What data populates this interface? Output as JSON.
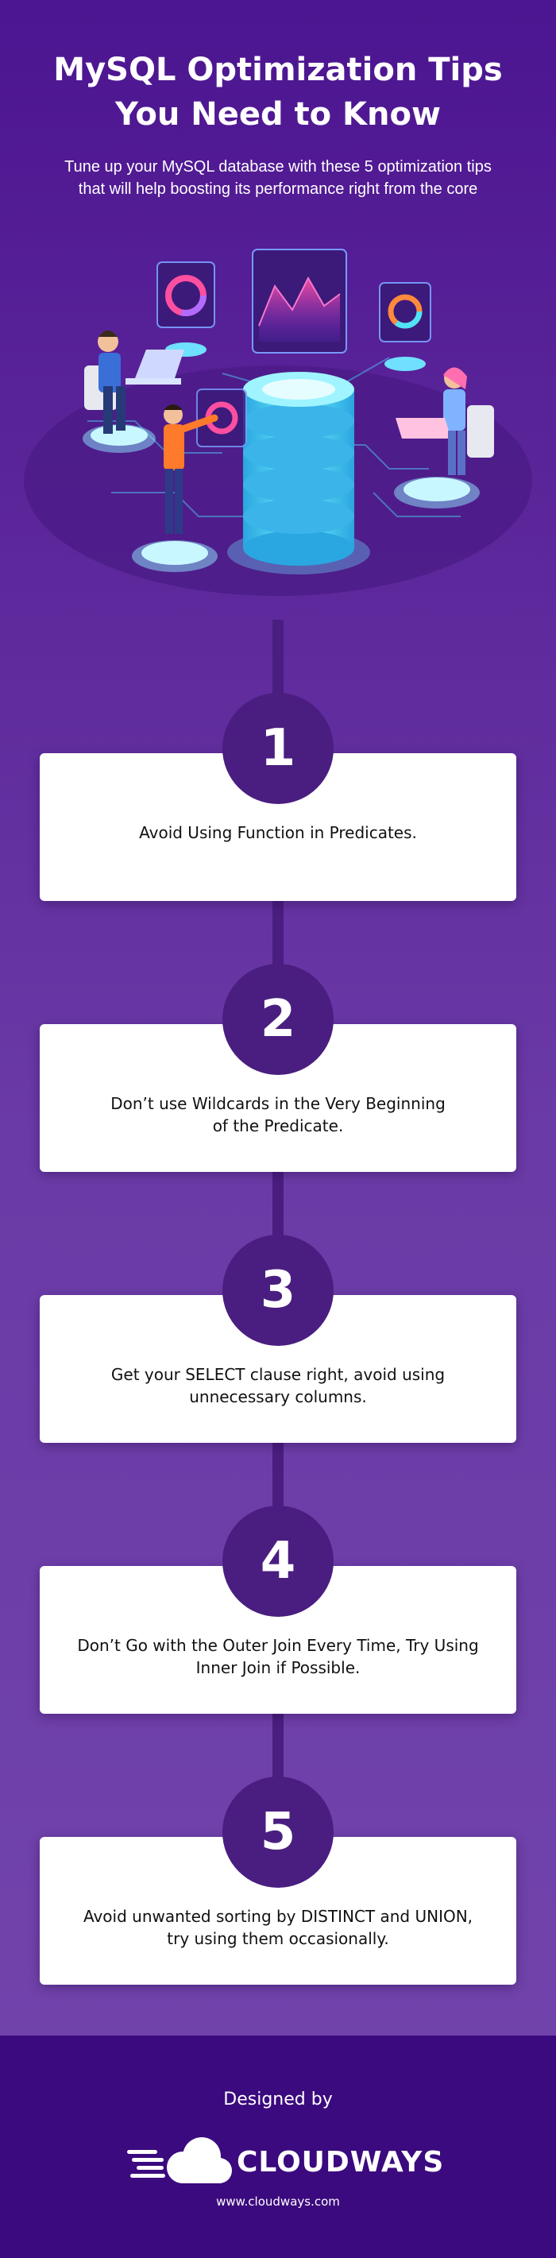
{
  "header": {
    "title_line1": "MySQL Optimization Tips",
    "title_line2": "You Need to Know",
    "subtitle_line1": "Tune up your MySQL database with these 5 optimization tips",
    "subtitle_line2": "that will help boosting its performance right from the core"
  },
  "tips": [
    {
      "number": "1",
      "line1": "Avoid Using Function in Predicates.",
      "line2": ""
    },
    {
      "number": "2",
      "line1": "Don’t use Wildcards in the Very Beginning",
      "line2": "of the Predicate."
    },
    {
      "number": "3",
      "line1": "Get your SELECT clause right, avoid using",
      "line2": "unnecessary columns."
    },
    {
      "number": "4",
      "line1": "Don’t Go with the Outer Join Every Time, Try Using",
      "line2": "Inner Join if Possible."
    },
    {
      "number": "5",
      "line1": "Avoid unwanted sorting by DISTINCT and UNION,",
      "line2": "try using them occasionally."
    }
  ],
  "footer": {
    "designed_by": "Designed by",
    "brand": "CLOUDWAYS",
    "url": "www.cloudways.com"
  },
  "colors": {
    "background_top": "#4c1591",
    "background_bottom": "#7245ac",
    "accent_purple": "#4a1e80",
    "footer_bg": "#3b0a7e",
    "card_bg": "#ffffff",
    "cyan": "#4fe3f5"
  },
  "icons": {
    "hero": "database-server-illustration",
    "logo": "cloud-icon"
  }
}
